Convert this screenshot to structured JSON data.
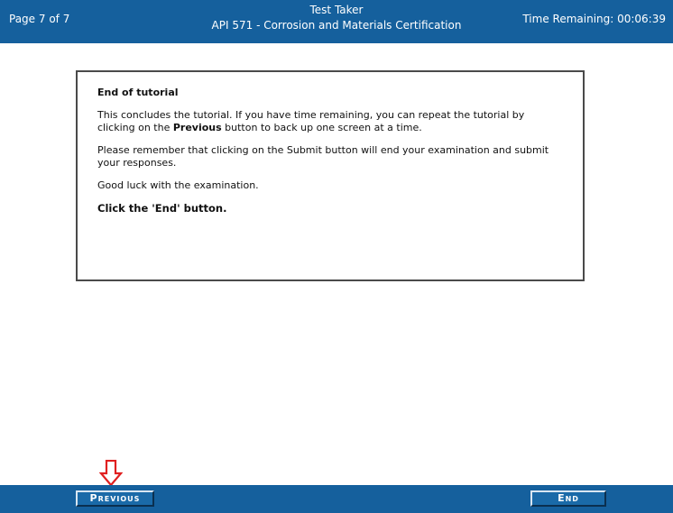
{
  "header": {
    "page_indicator": "Page 7 of 7",
    "candidate": "Test Taker",
    "exam_title": "API 571 - Corrosion and Materials Certification",
    "time_remaining": "Time Remaining: 00:06:39"
  },
  "content": {
    "heading": "End of tutorial",
    "para1_before": "This concludes the tutorial. If you have time remaining, you can repeat the tutorial by clicking on the ",
    "para1_bold": "Previous",
    "para1_after": " button to back up one screen at a time.",
    "para2": "Please remember that clicking on the Submit button will end your examination and submit your responses.",
    "para3": "Good luck with the examination.",
    "instruction": "Click the 'End' button."
  },
  "footer": {
    "previous_label": "Previous",
    "end_label": "End"
  },
  "colors": {
    "bar_blue": "#15609d",
    "annotation_red": "#e02020"
  },
  "annotation": {
    "icon": "down-arrow-icon"
  }
}
